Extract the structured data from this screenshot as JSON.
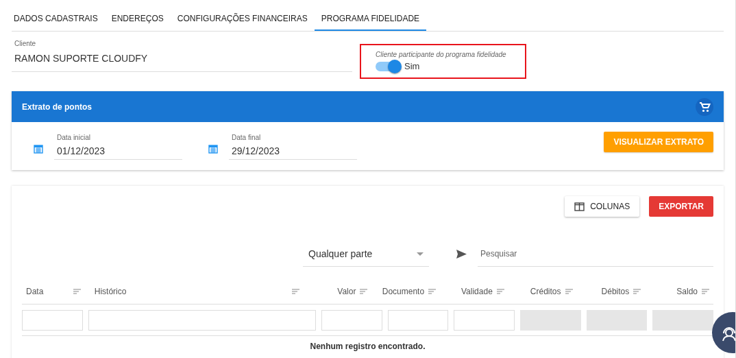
{
  "tabs": [
    {
      "label": "DADOS CADASTRAIS",
      "selected": false
    },
    {
      "label": "ENDEREÇOS",
      "selected": false
    },
    {
      "label": "CONFIGURAÇÕES FINANCEIRAS",
      "selected": false
    },
    {
      "label": "PROGRAMA FIDELIDADE",
      "selected": true
    }
  ],
  "client": {
    "label": "Cliente",
    "value": "RAMON SUPORTE CLOUDFY"
  },
  "loyalty": {
    "label": "Cliente participante do programa fidelidade",
    "on": true,
    "text": "Sim",
    "highlighted": true
  },
  "statement": {
    "title": "Extrato de pontos",
    "start": {
      "label": "Data inicial",
      "value": "01/12/2023"
    },
    "end": {
      "label": "Data final",
      "value": "29/12/2023"
    },
    "button": "VISUALIZAR EXTRATO"
  },
  "table": {
    "columns_button": "COLUNAS",
    "export_button": "EXPORTAR",
    "search_mode": "Qualquer parte",
    "search_placeholder": "Pesquisar",
    "columns": [
      {
        "label": "Data",
        "filter_disabled": false
      },
      {
        "label": "Histórico",
        "filter_disabled": false
      },
      {
        "label": "Valor",
        "filter_disabled": false
      },
      {
        "label": "Documento",
        "filter_disabled": false
      },
      {
        "label": "Validade",
        "filter_disabled": false
      },
      {
        "label": "Créditos",
        "filter_disabled": true
      },
      {
        "label": "Débitos",
        "filter_disabled": true
      },
      {
        "label": "Saldo",
        "filter_disabled": true
      }
    ],
    "empty_message": "Nenhum registro encontrado."
  }
}
